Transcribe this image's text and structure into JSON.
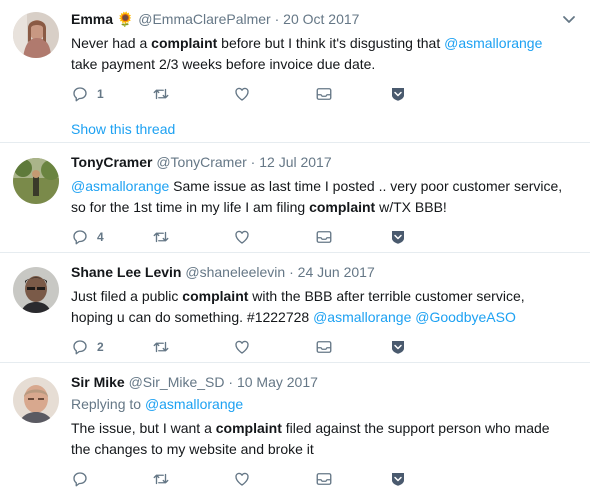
{
  "tweets": [
    {
      "name": "Emma",
      "emoji": "🌻",
      "handle": "@EmmaClarePalmer",
      "separator": "·",
      "date": "20 Oct 2017",
      "text": [
        {
          "t": "Never had a ",
          "s": "plain"
        },
        {
          "t": "complaint",
          "s": "bold"
        },
        {
          "t": " before but I think it's disgusting that ",
          "s": "plain"
        },
        {
          "t": "@asmallorange",
          "s": "link"
        },
        {
          "t": " take payment 2/3 weeks before invoice due date.",
          "s": "plain"
        }
      ],
      "reply_count": "1",
      "show_thread": "Show this thread"
    },
    {
      "name": "TonyCramer",
      "handle": "@TonyCramer",
      "separator": "·",
      "date": "12 Jul 2017",
      "text": [
        {
          "t": "@asmallorange",
          "s": "link"
        },
        {
          "t": " Same issue as last time I posted .. very poor customer service, so for the 1st time in my life I am filing ",
          "s": "plain"
        },
        {
          "t": "complaint",
          "s": "bold"
        },
        {
          "t": " w/TX BBB!",
          "s": "plain"
        }
      ],
      "reply_count": "4"
    },
    {
      "name": "Shane Lee Levin",
      "handle": "@shaneleelevin",
      "separator": "·",
      "date": "24 Jun 2017",
      "text": [
        {
          "t": "Just filed a public ",
          "s": "plain"
        },
        {
          "t": "complaint",
          "s": "bold"
        },
        {
          "t": " with the BBB after terrible customer service, hoping u can do something. #1222728 ",
          "s": "plain"
        },
        {
          "t": "@asmallorange",
          "s": "link"
        },
        {
          "t": " ",
          "s": "plain"
        },
        {
          "t": "@GoodbyeASO",
          "s": "link"
        }
      ],
      "reply_count": "2"
    },
    {
      "name": "Sir Mike",
      "handle": "@Sir_Mike_SD",
      "separator": "·",
      "date": "10 May 2017",
      "replying_prefix": "Replying to ",
      "replying_handle": "@asmallorange",
      "text": [
        {
          "t": "The issue, but I want a ",
          "s": "plain"
        },
        {
          "t": "complaint",
          "s": "bold"
        },
        {
          "t": " filed against the support person who made the changes to my website and broke it",
          "s": "plain"
        }
      ],
      "reply_count": ""
    }
  ],
  "icons": {
    "reply": "reply-icon",
    "retweet": "retweet-icon",
    "like": "heart-icon",
    "dm": "envelope-icon",
    "extra": "shield-icon",
    "more": "chevron-down-icon"
  },
  "colors": {
    "link": "#1da1f2",
    "muted": "#657786",
    "text": "#14171a",
    "divider": "#e6ecf0"
  }
}
